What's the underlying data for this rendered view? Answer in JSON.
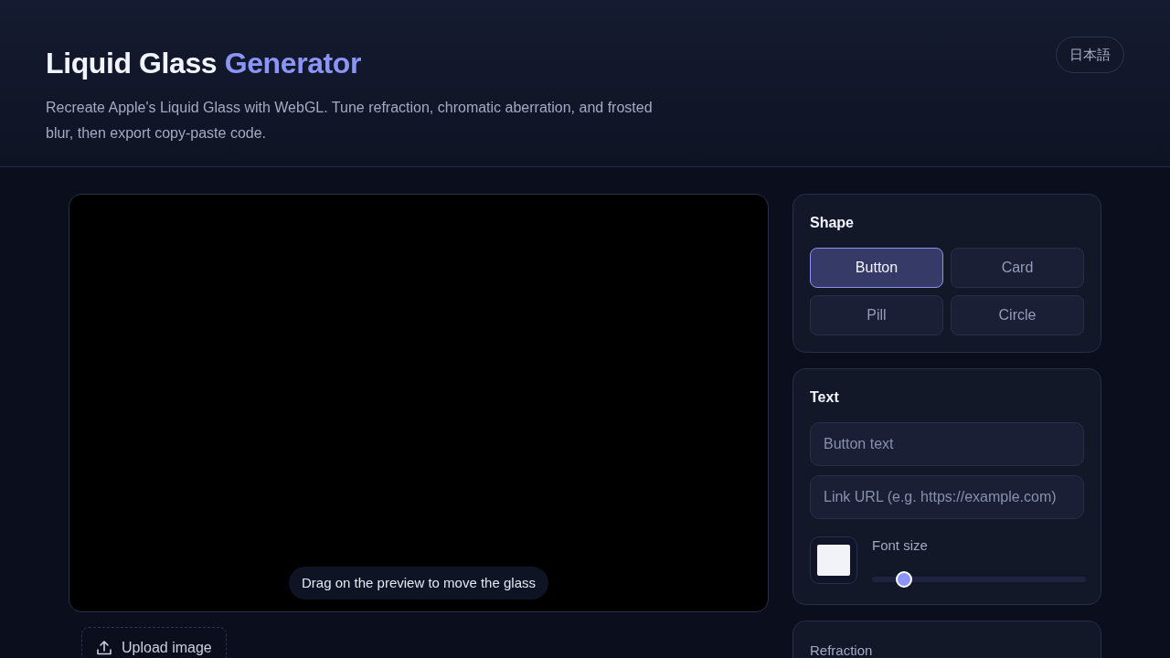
{
  "header": {
    "title": [
      {
        "text": "Liquid Glass",
        "accent": false
      },
      {
        "text": "Generator",
        "accent": true
      }
    ],
    "subtitle": "Recreate Apple's Liquid Glass with WebGL. Tune refraction, chromatic aberration, and frosted blur, then export copy-paste code.",
    "language_button": "日本語"
  },
  "preview": {
    "hint": "Drag on the preview to move the glass",
    "upload_button": "Upload image"
  },
  "shape_panel": {
    "title": "Shape",
    "options": [
      {
        "label": "Button",
        "selected": true
      },
      {
        "label": "Card",
        "selected": false
      },
      {
        "label": "Pill",
        "selected": false
      },
      {
        "label": "Circle",
        "selected": false
      }
    ]
  },
  "text_panel": {
    "title": "Text",
    "fields": [
      {
        "placeholder": "Button text"
      },
      {
        "placeholder": "Link URL (e.g. https://example.com)"
      }
    ],
    "font_size": {
      "label": "Font size",
      "level": 0.15
    }
  },
  "refraction_panel": {
    "label": "Refraction"
  }
}
